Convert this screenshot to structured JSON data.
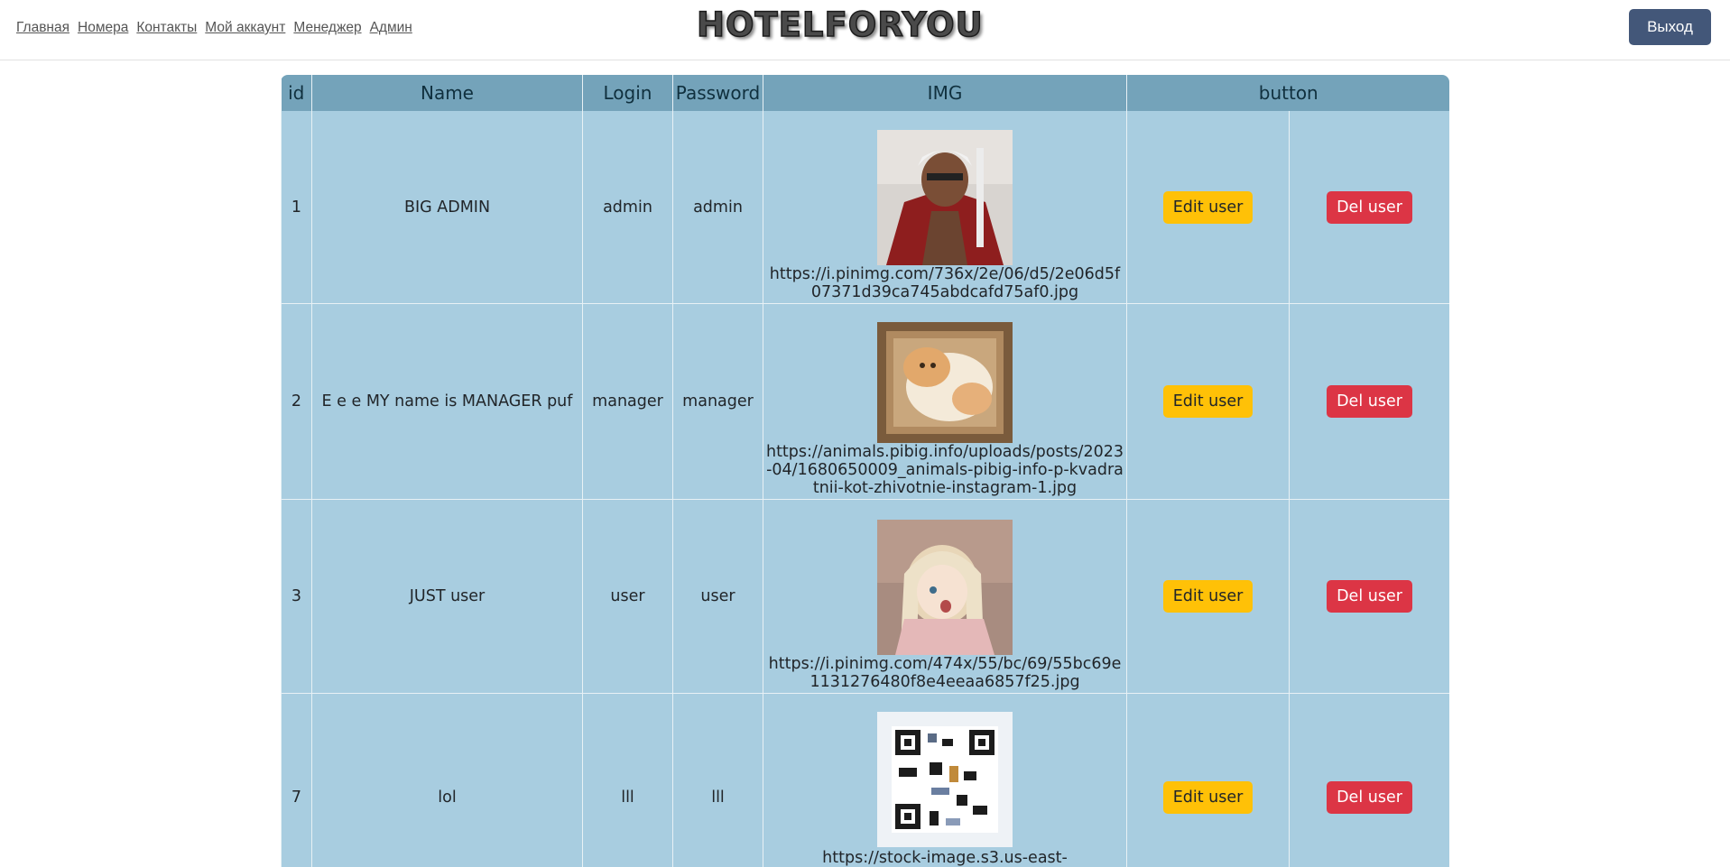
{
  "nav": {
    "links": [
      "Главная",
      "Номера",
      "Контакты",
      "Мой аккаунт",
      "Менеджер",
      "Админ"
    ]
  },
  "logo": "HOTELFORYOU",
  "logout_label": "Выход",
  "table": {
    "headers": [
      "id",
      "Name",
      "Login",
      "Password",
      "IMG",
      "button"
    ],
    "rows": [
      {
        "id": "1",
        "name": "BIG ADMIN",
        "login": "admin",
        "password": "admin",
        "img_url": "https://i.pinimg.com/736x/2e/06/d5/2e06d5f07371d39ca745abdcafd75af0.jpg",
        "edit": "Edit user",
        "del": "Del user"
      },
      {
        "id": "2",
        "name": "E e e MY name is MANAGER puf",
        "login": "manager",
        "password": "manager",
        "img_url": "https://animals.pibig.info/uploads/posts/2023-04/1680650009_animals-pibig-info-p-kvadratnii-kot-zhivotnie-instagram-1.jpg",
        "edit": "Edit user",
        "del": "Del user"
      },
      {
        "id": "3",
        "name": "JUST user",
        "login": "user",
        "password": "user",
        "img_url": "https://i.pinimg.com/474x/55/bc/69/55bc69e1131276480f8e4eeaa6857f25.jpg",
        "edit": "Edit user",
        "del": "Del user"
      },
      {
        "id": "7",
        "name": "lol",
        "login": "lll",
        "password": "lll",
        "img_url": "https://stock-image.s3.us-east-",
        "edit": "Edit user",
        "del": "Del user"
      }
    ]
  },
  "colors": {
    "header_bg": "#74a3ba",
    "cell_bg": "#a8cde0",
    "logout_bg": "#435779",
    "edit_bg": "#ffc107",
    "del_bg": "#dc3545"
  }
}
